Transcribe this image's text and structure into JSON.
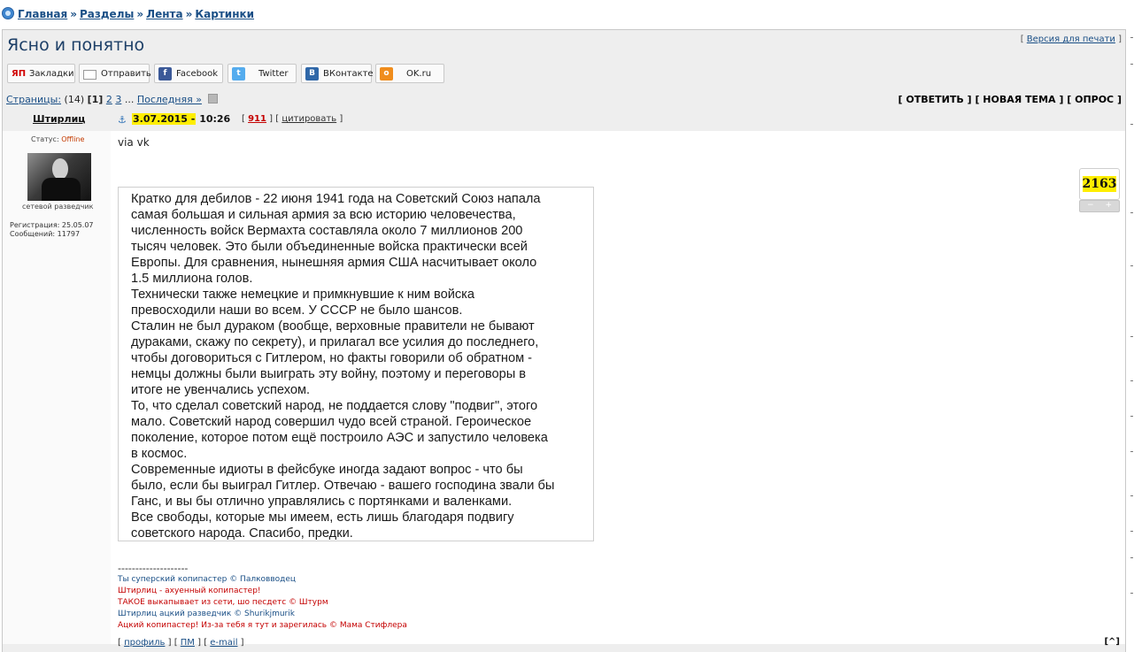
{
  "breadcrumb": {
    "items": [
      "Главная",
      "Разделы",
      "Лента",
      "Картинки"
    ],
    "sep": "»"
  },
  "topic": {
    "title": "Ясно и понятно",
    "print_prefix": "[",
    "print_label": "Версия для печати",
    "print_suffix": "]"
  },
  "share": {
    "yandex": "Закладки",
    "email": "Отправить",
    "facebook": "Facebook",
    "twitter": "Twitter",
    "vk": "ВКонтакте",
    "ok": "OK.ru"
  },
  "pagination": {
    "label": "Страницы:",
    "count": "(14)",
    "current": "[1]",
    "p2": "2",
    "p3": "3",
    "ellipsis": "...",
    "last": "Последняя »"
  },
  "actions": {
    "reply": "[ ОТВЕТИТЬ ]",
    "new_topic": "[ НОВАЯ ТЕМА ]",
    "poll": "[ ОПРОС ]"
  },
  "post": {
    "author": "Штирлиц",
    "date_highlight": "3.07.2015 -",
    "time": "10:26",
    "number": "911",
    "cite": "цитировать",
    "status_label": "Статус:",
    "status_value": "Offline",
    "rank": "сетевой разведчик",
    "registered": "Регистрация: 25.05.07",
    "messages": "Сообщений: 11797",
    "via": "via vk",
    "score": "2163",
    "quote": "Кратко для дебилов  - 22 июня 1941 года на Советский Союз напала\nсамая большая и сильная армия за всю историю человечества,\nчисленность войск Вермахта составляла около 7 миллионов 200\nтысяч человек. Это были объединенные войска практически всей\nЕвропы. Для сравнения, нынешняя армия США насчитывает около\n1.5 миллиона голов.\nТехнически также немецкие и примкнувшие к ним войска\nпревосходили наши во всем. У СССР не было шансов.\nСталин не был дураком (вообще, верховные правители не бывают\nдураками, скажу по секрету), и прилагал все усилия до последнего,\nчтобы договориться с Гитлером, но факты говорили об обратном -\nнемцы должны были выиграть эту войну, поэтому и переговоры в\nитоге не увенчались успехом.\nТо, что сделал советский народ, не поддается слову \"подвиг\", этого\nмало. Советский народ совершил чудо всей страной. Героическое\nпоколение, которое потом ещё построило АЭС и запустило человека\nв космос.\nСовременные идиоты в фейсбуке иногда задают вопрос - что бы\nбыло, если бы выиграл Гитлер. Отвечаю - вашего господина звали бы\nГанс, и вы бы отлично управлялись с портянками и валенками.\nВсе свободы, которые мы имеем, есть лишь благодаря подвигу\nсоветского народа. Спасибо, предки.",
    "signature": {
      "divider": "--------------------",
      "lines": [
        "Ты суперский копипастер © Палковводец",
        "Штирлиц - ахуенный копипастер!",
        "ТАКОЕ выкапывает из сети, шо песдетс © Штурм",
        "Штирлиц ацкий разведчик © Shurikjmurik",
        "Ацкий копипастер! Из-за тебя я тут и зарегилась © Мама Стифлера"
      ]
    },
    "footer": {
      "profile": "профиль",
      "pm": "ПМ",
      "email": "e-mail",
      "up": "[^]"
    }
  },
  "colors": {
    "highlight": "#ffee00",
    "link": "#1a4f86",
    "panel": "#eeeeee",
    "signature_red": "#c40000"
  }
}
